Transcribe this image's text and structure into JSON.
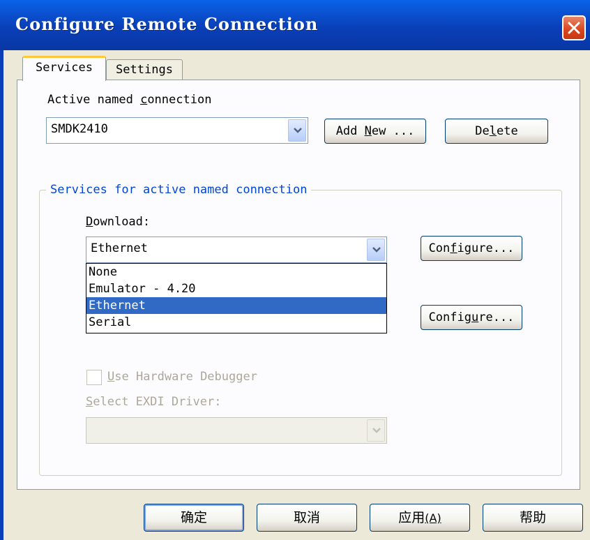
{
  "window": {
    "title": "Configure Remote Connection"
  },
  "tabs": [
    {
      "label": "Services",
      "active": true
    },
    {
      "label": "Settings",
      "active": false
    }
  ],
  "connection": {
    "label_before": "Active named ",
    "label_mnemonic": "c",
    "label_after": "onnection",
    "value": "SMDK2410",
    "add_new_before": "Add ",
    "add_new_mnemonic": "N",
    "add_new_after": "ew ...",
    "delete_before": "De",
    "delete_mnemonic": "l",
    "delete_after": "ete"
  },
  "services_group": {
    "legend": "Services for active named connection",
    "download_label_mnemonic": "D",
    "download_label_rest": "ownload:",
    "download_value": "Ethernet",
    "download_options": [
      "None",
      "Emulator - 4.20",
      "Ethernet",
      "Serial"
    ],
    "selected_option": "Ethernet",
    "configure1_before": "Con",
    "configure1_mnemonic": "f",
    "configure1_after": "igure...",
    "configure2_before": "Config",
    "configure2_mnemonic": "u",
    "configure2_after": "re...",
    "hw_debugger_mnemonic": "U",
    "hw_debugger_rest": "se Hardware Debugger",
    "exdi_mnemonic": "S",
    "exdi_rest": "elect EXDI Driver:"
  },
  "footer": {
    "ok": "确定",
    "cancel": "取消",
    "apply_text": "应用",
    "apply_mnemonic": "(A)",
    "help": "帮助"
  },
  "colors": {
    "title_bar": "#0A3FB8",
    "selection": "#316AC5",
    "group_legend": "#0046D5",
    "tab_highlight": "#FFC83C",
    "close_button": "#D9441C"
  }
}
